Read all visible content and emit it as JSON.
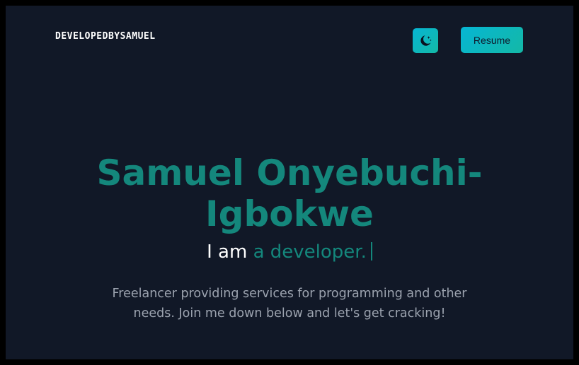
{
  "header": {
    "brand": "DEVELOPEDBYSAMUEL",
    "theme_toggle_icon": "moon-stars-icon",
    "resume_label": "Resume"
  },
  "hero": {
    "name": "Samuel Onyebuchi-Igbokwe",
    "tagline_prefix": "I am",
    "tagline_typed": "a developer.",
    "intro": "Freelancer providing services for programming and other needs. Join me down below and let's get cracking!"
  },
  "colors": {
    "background": "#111827",
    "accent": "#14877c",
    "button_gradient_start": "#06b6d4",
    "button_gradient_end": "#14b8a6"
  }
}
